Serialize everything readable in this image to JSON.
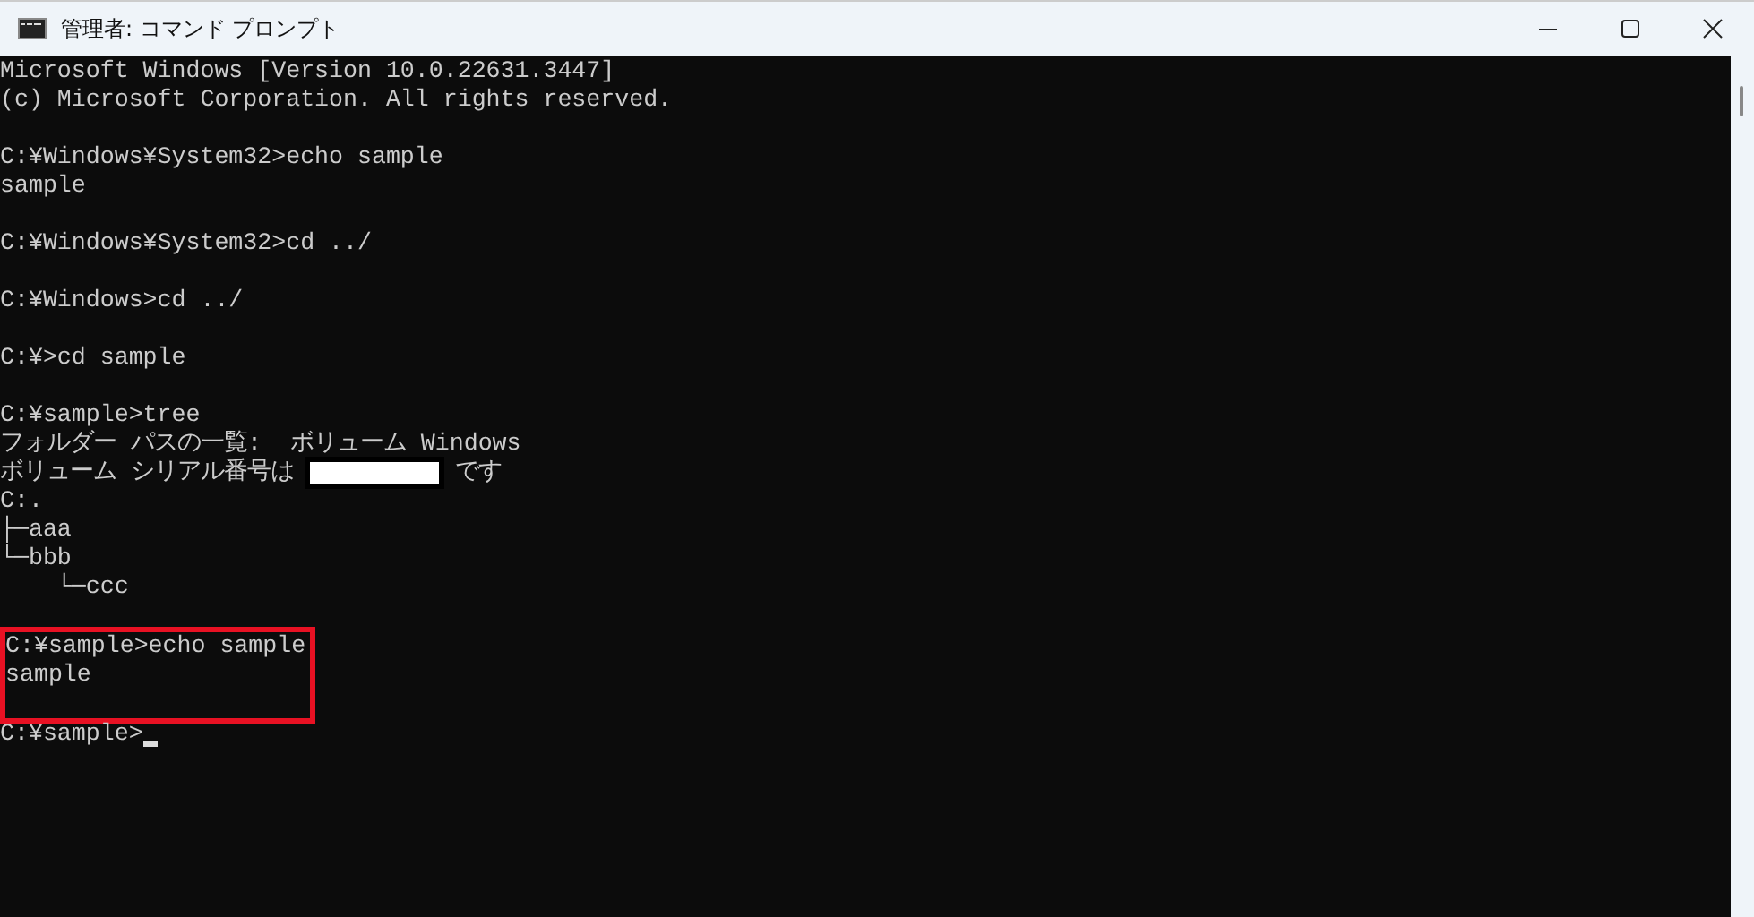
{
  "window": {
    "title": "管理者: コマンド プロンプト"
  },
  "console": {
    "segments": [
      {
        "kind": "plain",
        "lines": [
          {
            "kind": "text",
            "text": "Microsoft Windows [Version 10.0.22631.3447]"
          },
          {
            "kind": "text",
            "text": "(c) Microsoft Corporation. All rights reserved."
          },
          {
            "kind": "blank"
          },
          {
            "kind": "text",
            "text": "C:¥Windows¥System32>echo sample"
          },
          {
            "kind": "text",
            "text": "sample"
          },
          {
            "kind": "blank"
          },
          {
            "kind": "text",
            "text": "C:¥Windows¥System32>cd ../"
          },
          {
            "kind": "blank"
          },
          {
            "kind": "text",
            "text": "C:¥Windows>cd ../"
          },
          {
            "kind": "blank"
          },
          {
            "kind": "text",
            "text": "C:¥>cd sample"
          },
          {
            "kind": "blank"
          },
          {
            "kind": "text",
            "text": "C:¥sample>tree"
          },
          {
            "kind": "text",
            "text": "フォルダー パスの一覧:  ボリューム Windows"
          },
          {
            "kind": "masked",
            "text": "ボリューム シリアル番号は",
            "suffix": "です"
          },
          {
            "kind": "text",
            "text": "C:."
          },
          {
            "kind": "text",
            "text": "├─aaa"
          },
          {
            "kind": "text",
            "text": "└─bbb"
          },
          {
            "kind": "text",
            "text": "    └─ccc"
          },
          {
            "kind": "blank"
          }
        ]
      },
      {
        "kind": "framed",
        "lines": [
          {
            "kind": "text",
            "text": "C:¥sample>echo sample"
          },
          {
            "kind": "text",
            "text": "sample"
          },
          {
            "kind": "blank"
          }
        ]
      },
      {
        "kind": "plain",
        "lines": [
          {
            "kind": "prompt",
            "text": "C:¥sample>"
          }
        ]
      }
    ]
  }
}
